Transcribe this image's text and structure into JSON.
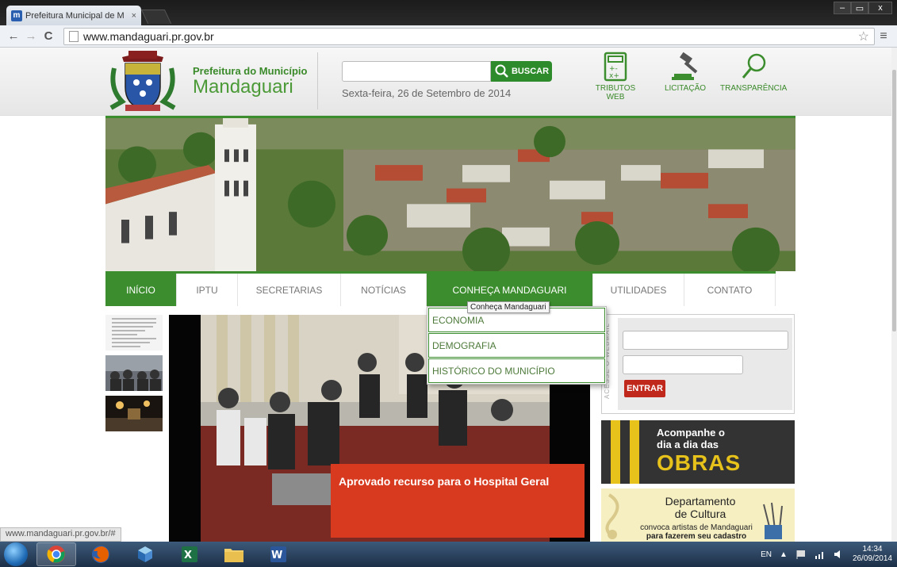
{
  "browser": {
    "tab_title": "Prefeitura Municipal de M",
    "tab_close": "×",
    "url": "www.mandaguari.pr.gov.br",
    "back": "←",
    "forward": "→",
    "reload": "C",
    "star": "☆",
    "menu": "≡",
    "favicon_letter": "m",
    "window_controls": [
      "–",
      "▭",
      "x"
    ]
  },
  "header": {
    "brand_line1": "Prefeitura do Município",
    "brand_line2": "Mandaguari",
    "search_button": "BUSCAR",
    "date": "Sexta-feira, 26 de Setembro de 2014",
    "quick_links": [
      {
        "label": "TRIBUTOS WEB",
        "icon": "calculator-icon"
      },
      {
        "label": "LICITAÇÃO",
        "icon": "gavel-icon"
      },
      {
        "label": "TRANSPARÊNCIA",
        "icon": "magnifier-icon"
      }
    ]
  },
  "nav": {
    "items": [
      "INÍCIO",
      "IPTU",
      "SECRETARIAS",
      "NOTÍCIAS",
      "CONHEÇA MANDAGUARI",
      "UTILIDADES",
      "CONTATO"
    ],
    "tooltip": "Conheça Mandaguari",
    "dropdown": [
      "ECONOMIA",
      "DEMOGRAFIA",
      "HISTÓRICO DO MUNICÍPIO"
    ]
  },
  "slider": {
    "caption": "Aprovado recurso para o Hospital Geral"
  },
  "login": {
    "vertical_label": "ACESSE O WEBMAIL",
    "enter_button": "ENTRAR"
  },
  "ads": {
    "obras_line1": "Acompanhe o",
    "obras_line2": "dia a dia das",
    "obras_big": "OBRAS",
    "cultura_title1": "Departamento",
    "cultura_title2": "de Cultura",
    "cultura_sub1": "convoca artistas de Mandaguari",
    "cultura_sub2": "para fazerem seu cadastro"
  },
  "status_url": "www.mandaguari.pr.gov.br/#",
  "taskbar": {
    "lang": "EN",
    "time": "14:34",
    "date": "26/09/2014"
  },
  "colors": {
    "green": "#3c8d2e",
    "red": "#d83a1f"
  }
}
